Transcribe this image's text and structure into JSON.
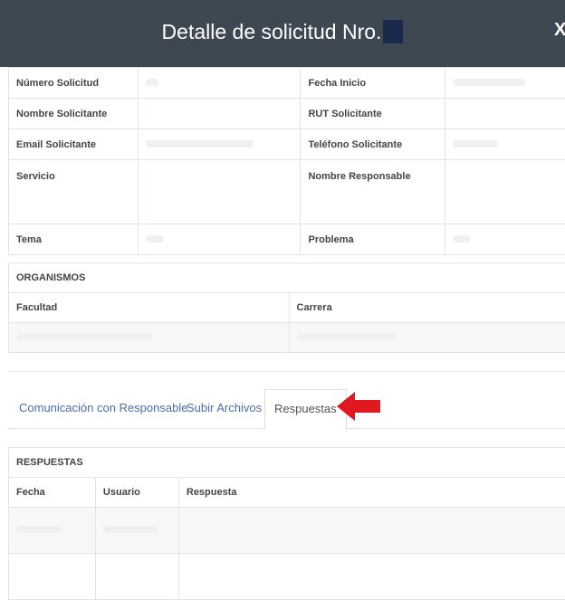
{
  "modal": {
    "title": "Detalle de solicitud Nro.",
    "close_label": "X"
  },
  "info": {
    "rows": [
      {
        "l1": "Número Solicitud",
        "l2": "Fecha Inicio"
      },
      {
        "l1": "Nombre Solicitante",
        "l2": "RUT Solicitante"
      },
      {
        "l1": "Email Solicitante",
        "l2": "Teléfono Solicitante"
      },
      {
        "l1": "Servicio",
        "l2": "Nombre Responsable"
      },
      {
        "l1": "Tema",
        "l2": "Problema"
      }
    ]
  },
  "organismos": {
    "title": "ORGANISMOS",
    "col1": "Facultad",
    "col2": "Carrera"
  },
  "tabs": {
    "comunicacion": "Comunicación con Responsable",
    "subir": "Subir Archivos",
    "respuestas": "Respuestas"
  },
  "respuestas": {
    "title": "RESPUESTAS",
    "col_fecha": "Fecha",
    "col_usuario": "Usuario",
    "col_respuesta": "Respuesta"
  },
  "colors": {
    "header_bg": "#3d4853",
    "arrow": "#e0181f",
    "tab_link": "#4a6ea8"
  }
}
